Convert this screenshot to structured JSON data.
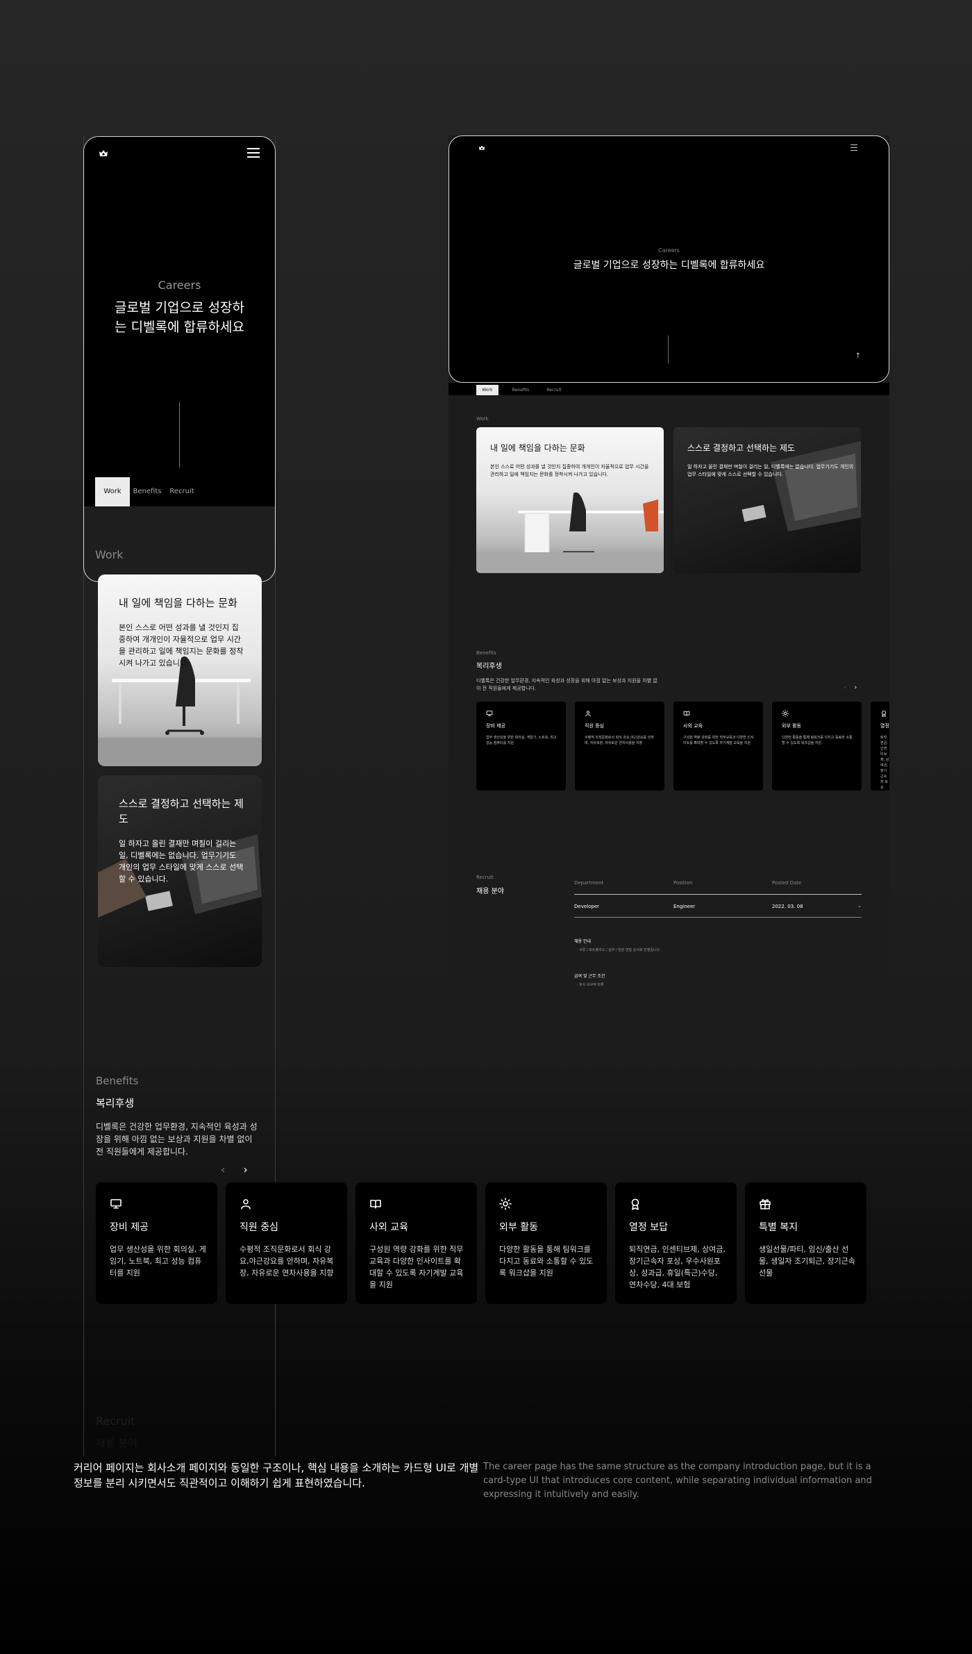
{
  "mobile": {
    "hero": {
      "eyebrow": "Careers",
      "title": "글로벌 기업으로 성장하는 디벨록에 합류하세요"
    },
    "tabs": [
      "Work",
      "Benefits",
      "Recruit"
    ],
    "work": {
      "label": "Work",
      "cards": [
        {
          "title": "내 일에 책임을 다하는 문화",
          "desc": "본인 스스로 어떤 성과를 낼 것인지 집중하여 개개인이 자율적으로 업무 시간을 관리하고 일에 책임지는 문화를 정착시켜 나가고 있습니다."
        },
        {
          "title": "스스로 결정하고 선택하는 제도",
          "desc": "일 하자고 올린 결재만 며칠이 걸리는 일, 디벨록에는 없습니다. 업무기기도 개인의 업무 스타일에 맞게 스스로 선택할 수 있습니다."
        }
      ]
    },
    "benefits": {
      "label": "Benefits",
      "title": "복리후생",
      "desc": "디벨록은 건강한 업무환경, 지속적인 육성과 성장을 위해 아낌 없는 보상과 지원을 차별 없이 전 직원들에게 제공합니다.",
      "prev": "‹",
      "next": "›",
      "cards": [
        {
          "icon": "monitor-icon",
          "title": "장비 제공",
          "desc": "업무 생산성을 위한 회의실, 게임기, 노트북, 최고 성능 컴퓨터를 지원"
        },
        {
          "icon": "user-icon",
          "title": "직원 중심",
          "desc": "수평적 조직문화로서 회식 강요,야근강요를 안하며, 자유복장, 자유로운 연차사용을 지향"
        },
        {
          "icon": "book-icon",
          "title": "사외 교육",
          "desc": "구성원 역량 강화를 위한 직무교육과 다양한 인사이트를 확대할 수 있도록 자기계발 교육을 지원"
        },
        {
          "icon": "sun-icon",
          "title": "외부 활동",
          "desc": "다양한 활동을 통해 팀워크를 다지고 동료와 소통할 수 있도록 워크샵을 지원"
        },
        {
          "icon": "medal-icon",
          "title": "열정 보답",
          "desc": "퇴직연금, 인센티브제, 상여금, 장기근속자 포상, 우수사원포상, 성과급, 휴일(특근)수당, 연차수당, 4대 보험"
        },
        {
          "icon": "gift-icon",
          "title": "특별 복지",
          "desc": "생일선물/파티, 임신/출산 선물, 생일자 조기퇴근, 장기근속 선물"
        }
      ]
    }
  },
  "desktop": {
    "hero": {
      "eyebrow": "Careers",
      "title": "글로벌 기업으로 성장하는 디벨록에 합류하세요",
      "up_arrow": "↑"
    },
    "tabs": [
      "Work",
      "Benefits",
      "Recruit"
    ],
    "work": {
      "label": "Work",
      "cards": [
        {
          "title": "내 일에 책임을 다하는 문화",
          "desc": "본인 스스로 어떤 성과를 낼 것인지 집중하여 개개인이 자율적으로 업무 시간을 관리하고 일에 책임지는 문화를 정착시켜 나가고 있습니다."
        },
        {
          "title": "스스로 결정하고 선택하는 제도",
          "desc": "일 하자고 올린 결재만 며칠이 걸리는 일, 디벨록에는 없습니다. 업무기기도 개인의 업무 스타일에 맞게 스스로 선택할 수 있습니다."
        }
      ]
    },
    "benefits": {
      "label": "Benefits",
      "title": "복리후생",
      "desc": "디벨록은 건강한 업무환경, 지속적인 육성과 성장을 위해 아낌 없는 보상과 지원을 차별 없이 전 직원들에게 제공합니다.",
      "prev": "‹",
      "next": "›",
      "cards": [
        {
          "icon": "monitor-icon",
          "title": "장비 제공",
          "desc": "업무 생산성을 위한 회의실, 게임기, 노트북, 최고 성능 컴퓨터를 지원"
        },
        {
          "icon": "user-icon",
          "title": "직원 중심",
          "desc": "수평적 조직문화로서 회식 강요,야근강요를 안하며, 자유복장, 자유로운 연차사용을 지향"
        },
        {
          "icon": "book-icon",
          "title": "사외 교육",
          "desc": "구성원 역량 강화를 위한 직무교육과 다양한 인사이트를 확대할 수 있도록 자기계발 교육을 지원"
        },
        {
          "icon": "sun-icon",
          "title": "외부 활동",
          "desc": "다양한 활동을 통해 팀워크를 다지고 동료와 소통할 수 있도록 워크샵을 지원"
        },
        {
          "icon": "medal-icon",
          "title": "열정 보답",
          "desc": "퇴직연금, 인센티브제, 상여금, 장기근속자 포상"
        }
      ]
    },
    "recruit": {
      "label": "Recruit",
      "title": "채용 분야",
      "columns": [
        "Department",
        "Position",
        "Posted Date"
      ],
      "rows": [
        {
          "department": "Developer",
          "position": "Engineer",
          "posted_date": "2022. 03. 08"
        }
      ],
      "caret": "⌄",
      "section1_title": "채용 안내",
      "section1_item": "· 서류 / 포트폴리오 / 실무 / 임원 면접 순서로 진행됩니다",
      "section2_title": "급여 및 근무 조건",
      "section2_item": "· 회사 내규에 따름"
    }
  },
  "footer_text": {
    "korean": "커리어 페이지는 회사소개 페이지와 동일한 구조이나, 핵심 내용을 소개하는 카드형 UI로 개별정보를 분리 시키면서도 직관적이고 이해하기 쉽게 표현하였습니다.",
    "english": "The career page has the same structure as the company introduction page, but it is a card-type UI that introduces core content, while separating individual information and expressing it intuitively and easily."
  }
}
